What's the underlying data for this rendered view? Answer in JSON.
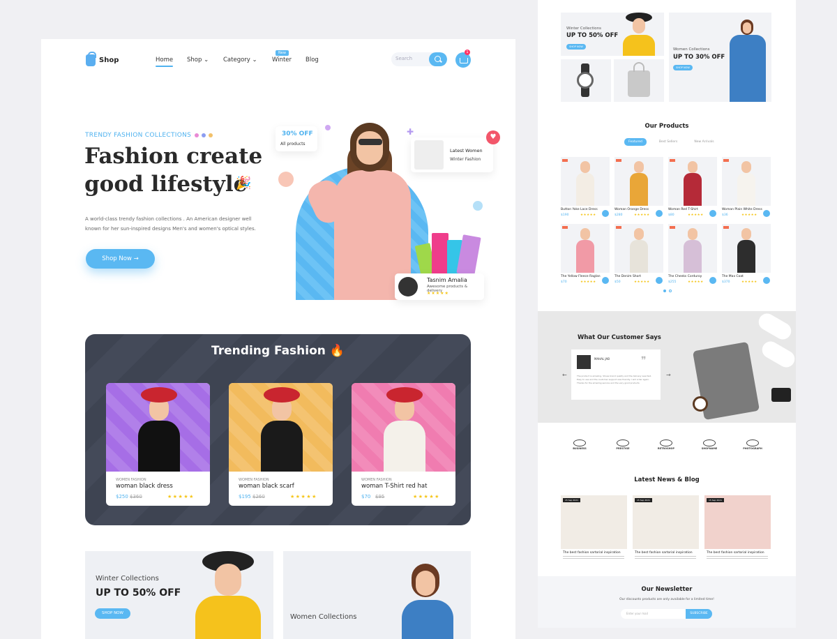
{
  "nav": {
    "logo": "Shop",
    "items": [
      "Home",
      "Shop",
      "Category",
      "Winter",
      "Blog"
    ],
    "winter_badge": "New",
    "search_placeholder": "Search",
    "cart_count": "1"
  },
  "hero": {
    "eyebrow": "TRENDY FASHION COLLECTIONS",
    "title": "Fashion create good lifestyle",
    "description": "A world-class trendy fashion collections . An American designer well known for her sun-inspired designs Men's and women's optical styles.",
    "cta": "Shop Now →",
    "offer_title": "30% OFF",
    "offer_sub": "All products",
    "latest_title": "Latest Women",
    "latest_sub": "Winter Fashion",
    "reviewer_name": "Tasnim Amalia",
    "reviewer_text": "Awesome products & delivery",
    "reviewer_stars": "★★★★★"
  },
  "trending": {
    "title": "Trending Fashion 🔥",
    "products": [
      {
        "category": "WOMEN FASHION",
        "name": "woman black dress",
        "price": "$250",
        "old_price": "$360",
        "stars": "★★★★★",
        "bg": "#a66ee6",
        "body": "#111"
      },
      {
        "category": "WOMEN FASHION",
        "name": "woman black scarf",
        "price": "$195",
        "old_price": "$260",
        "stars": "★★★★★",
        "bg": "#f2bb5d",
        "body": "#1a1a1a"
      },
      {
        "category": "WOMEN FASHION",
        "name": "woman T-Shirt red hat",
        "price": "$70",
        "old_price": "$95",
        "stars": "★★★★★",
        "bg": "#f07cb0",
        "body": "#f4f1ea"
      }
    ]
  },
  "promos": {
    "winter_label": "Winter Collections",
    "winter_offer": "UP TO 50% OFF",
    "winter_cta": "SHOP NOW",
    "women_label": "Women Collections"
  },
  "right": {
    "winter_label": "Winter Collections",
    "winter_offer": "UP TO 50% OFF",
    "winter_cta": "SHOP NOW",
    "women_label": "Women Collections",
    "women_offer": "UP TO 30% OFF",
    "women_cta": "SHOP NOW",
    "products_title": "Our Products",
    "tabs": [
      "Featured",
      "Best Sellers",
      "New Arrivals"
    ],
    "products": [
      {
        "name": "Button Yoke Lace Dress",
        "price": "$190",
        "bg": "#f3ede4"
      },
      {
        "name": "Woman Orange Dress",
        "price": "$280",
        "bg": "#e9a638"
      },
      {
        "name": "Woman Red T-Shirt",
        "price": "$80",
        "bg": "#b52a38"
      },
      {
        "name": "Woman Plain White Dress",
        "price": "$36",
        "bg": "#f6f3ee"
      },
      {
        "name": "The Yellow Fleece Raglan",
        "price": "$70",
        "bg": "#f19aa6"
      },
      {
        "name": "The Denim Short",
        "price": "$50",
        "bg": "#e7e3da"
      },
      {
        "name": "The Cheeks Corduroy",
        "price": "$255",
        "bg": "#d6bfd7"
      },
      {
        "name": "The Max Coat",
        "price": "$370",
        "bg": "#2d2d2d"
      }
    ],
    "stars": "★★★★★",
    "testimonial_title": "What Our Customer Says",
    "testimonial_name": "MAHAL JAB",
    "testimonial_text": "The product is amazing. Shoes brand quality and the delivery was fast. Easy to use and the customer support was friendly. I will order again. Thanks for the amazing service and the very good products",
    "brands": [
      "BUSINESS",
      "PRESTIGE",
      "RETROSHOP",
      "SHOPNAME",
      "PHOTOGRAPH"
    ],
    "news_title": "Latest News & Blog",
    "news": [
      {
        "tag": "15 Sep 2021",
        "title": "The best fashion sartorial inspiration"
      },
      {
        "tag": "15 Sep 2021",
        "title": "The best fashion sartorial inspiration"
      },
      {
        "tag": "15 Sep 2021",
        "title": "The best fashion sartorial inspiration"
      }
    ],
    "newsletter_title": "Our Newsletter",
    "newsletter_sub": "Our discounts products are only available for a limited time!",
    "newsletter_placeholder": "Enter your mail",
    "newsletter_cta": "SUBSCRIBE"
  }
}
